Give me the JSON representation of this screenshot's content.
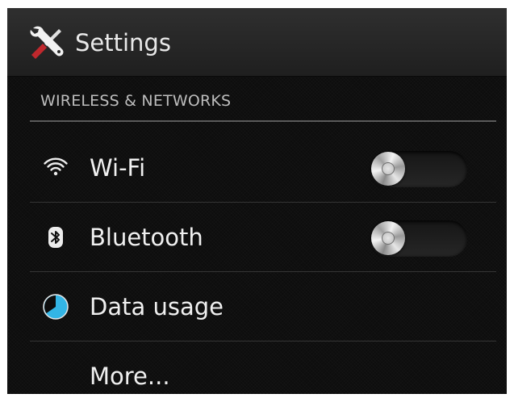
{
  "action_bar": {
    "title": "Settings",
    "icon": "settings-tools-icon"
  },
  "section": {
    "header": "WIRELESS & NETWORKS"
  },
  "items": [
    {
      "label": "Wi-Fi",
      "icon": "wifi-icon",
      "toggle": "off"
    },
    {
      "label": "Bluetooth",
      "icon": "bluetooth-icon",
      "toggle": "off"
    },
    {
      "label": "Data usage",
      "icon": "data-usage-icon"
    },
    {
      "label": "More..."
    }
  ],
  "colors": {
    "background": "#0d0d0d",
    "action_bar": "#2a2a2a",
    "text": "#f0f0f0",
    "section_header": "#bdbdbd",
    "accent_blue": "#33b5e5",
    "tool_red": "#c0282d"
  }
}
